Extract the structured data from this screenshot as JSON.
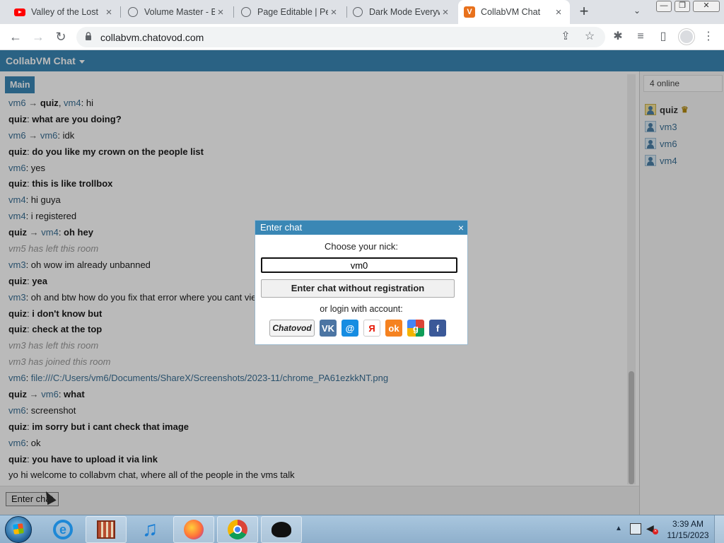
{
  "browser": {
    "tabs": [
      {
        "title": "Valley of the Lost",
        "icon": "youtube-icon"
      },
      {
        "title": "Volume Master - B",
        "icon": "globe-icon"
      },
      {
        "title": "Page Editable | Pe",
        "icon": "globe-icon"
      },
      {
        "title": "Dark Mode Everyw",
        "icon": "globe-icon"
      },
      {
        "title": "CollabVM Chat",
        "icon": "collabvm-icon",
        "active": true
      }
    ],
    "new_tab": "+",
    "url": "collabvm.chatovod.com",
    "window_buttons": [
      "—",
      "❐",
      "✕"
    ]
  },
  "app": {
    "title": "CollabVM Chat",
    "room_tab": "Main",
    "online_count": "4 online",
    "users": [
      {
        "name": "quiz",
        "crown": true
      },
      {
        "name": "vm3"
      },
      {
        "name": "vm6"
      },
      {
        "name": "vm4"
      }
    ],
    "messages": [
      {
        "from": "vm6",
        "to": "quiz",
        "cc": "vm4",
        "text": "hi"
      },
      {
        "from": "quiz",
        "text": "what are you doing?",
        "bold": true
      },
      {
        "from": "vm6",
        "to": "vm6",
        "text": "idk"
      },
      {
        "from": "quiz",
        "text": "do you like my crown on the people list",
        "bold": true
      },
      {
        "from": "vm6",
        "text": "yes"
      },
      {
        "from": "quiz",
        "text": "this is like trollbox",
        "bold": true
      },
      {
        "from": "vm4",
        "text": "hi guya"
      },
      {
        "from": "vm4",
        "text": "i registered"
      },
      {
        "from": "quiz",
        "to": "vm4",
        "text": "oh hey",
        "bold": true
      },
      {
        "system": "vm5 has left this room"
      },
      {
        "from": "vm3",
        "text": "oh wow im already unbanned"
      },
      {
        "from": "quiz",
        "text": "yea",
        "bold": true
      },
      {
        "from": "vm3",
        "text": "oh and btw how do you fix that error where you cant vie"
      },
      {
        "from": "quiz",
        "text": "i don't know but",
        "bold": true
      },
      {
        "from": "quiz",
        "text": "check at the top",
        "bold": true
      },
      {
        "system": "vm3 has left this room"
      },
      {
        "system": "vm3 has joined this room"
      },
      {
        "from": "vm6",
        "text": "file:///C:/Users/vm6/Documents/ShareX/Screenshots/2023-11/chrome_PA61ezkkNT.png",
        "link": true
      },
      {
        "from": "quiz",
        "to": "vm6",
        "text": "what",
        "bold": true
      },
      {
        "from": "vm6",
        "text": "screenshot"
      },
      {
        "from": "quiz",
        "text": "im sorry but i cant check that image",
        "bold": true
      },
      {
        "from": "vm6",
        "text": "ok"
      },
      {
        "from": "quiz",
        "text": "you have to upload it via link",
        "bold": true
      },
      {
        "plain": "yo hi welcome to collabvm chat, where all of the people in the vms talk"
      }
    ],
    "enter_chat_button": "Enter chat",
    "arrow_glyph": "→"
  },
  "dialog": {
    "title": "Enter chat",
    "close": "×",
    "nick_label": "Choose your nick:",
    "nick_value": "vm0",
    "enter_without_registration": "Enter chat without registration",
    "or_login": "or login with account:",
    "providers": [
      {
        "name": "Chatovod",
        "label": "Chatovod",
        "color": "#f4f4f4"
      },
      {
        "name": "vk",
        "label": "VK",
        "color": "#4c75a3"
      },
      {
        "name": "mailru",
        "label": "@",
        "color": "#168de2"
      },
      {
        "name": "yandex",
        "label": "Я",
        "color": "#ffffff"
      },
      {
        "name": "odnoklassniki",
        "label": "ok",
        "color": "#f58220"
      },
      {
        "name": "google",
        "label": "g",
        "color": "#4285f4"
      },
      {
        "name": "facebook",
        "label": "f",
        "color": "#3b5998"
      }
    ]
  },
  "taskbar": {
    "time": "3:39 AM",
    "date": "11/15/2023"
  }
}
